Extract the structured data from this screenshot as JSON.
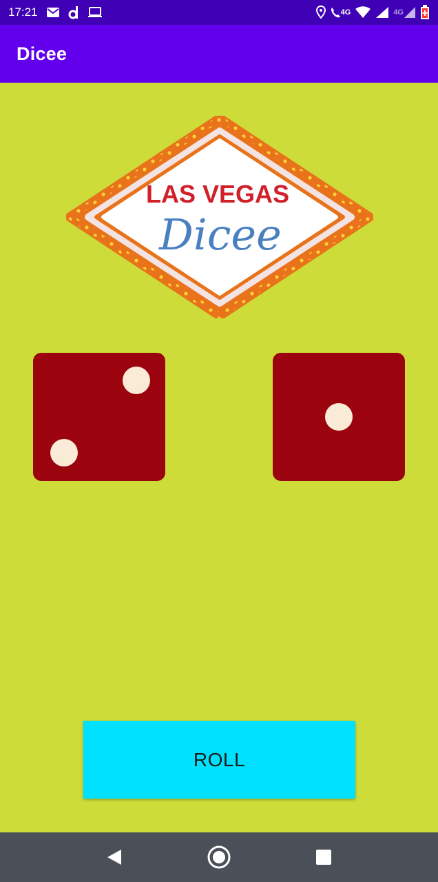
{
  "status_bar": {
    "time": "17:21",
    "network_1": "4G",
    "network_2": "4G",
    "icons": [
      "mail-icon",
      "d-app-icon",
      "laptop-icon",
      "location-icon",
      "wifi-calling-icon",
      "wifi-icon",
      "signal-icon",
      "battery-low-icon"
    ]
  },
  "app_bar": {
    "title": "Dicee"
  },
  "logo": {
    "line1": "LAS VEGAS",
    "line2": "Dicee"
  },
  "dice": {
    "left": {
      "value": 2
    },
    "right": {
      "value": 1
    }
  },
  "roll_button": {
    "label": "ROLL"
  },
  "nav_bar": {
    "icons": [
      "back-icon",
      "home-icon",
      "recents-icon"
    ]
  },
  "colors": {
    "status_bar": "#3f00b5",
    "app_bar": "#6200ee",
    "background": "#cddc39",
    "dice": "#9b040e",
    "pip": "#faebd7",
    "button": "#00e0ff",
    "nav_bar": "#4b5058",
    "logo_text_red": "#d0202a",
    "logo_text_blue": "#4a80c0",
    "logo_frame": "#e8731a"
  }
}
